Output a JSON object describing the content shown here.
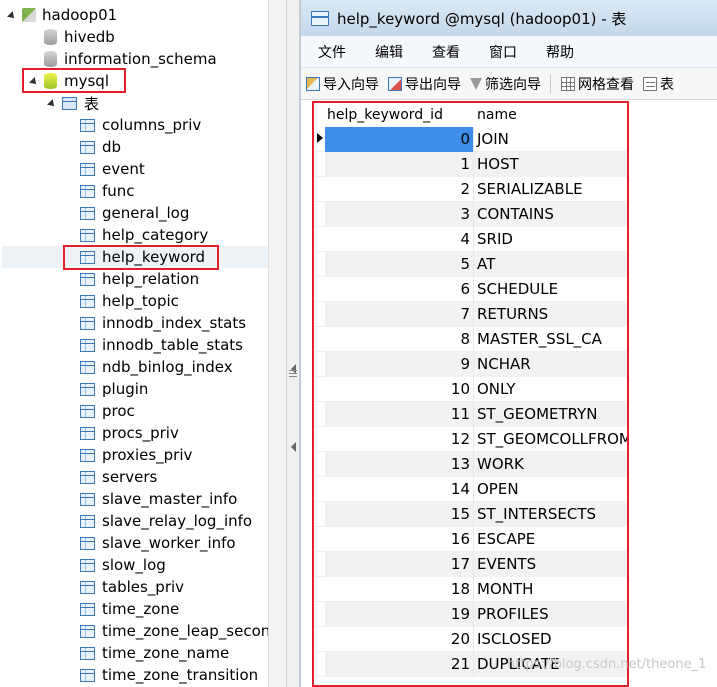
{
  "tree": {
    "connection": "hadoop01",
    "databases": [
      "hivedb",
      "information_schema",
      "mysql"
    ],
    "tables_folder": "表",
    "tables": [
      "columns_priv",
      "db",
      "event",
      "func",
      "general_log",
      "help_category",
      "help_keyword",
      "help_relation",
      "help_topic",
      "innodb_index_stats",
      "innodb_table_stats",
      "ndb_binlog_index",
      "plugin",
      "proc",
      "procs_priv",
      "proxies_priv",
      "servers",
      "slave_master_info",
      "slave_relay_log_info",
      "slave_worker_info",
      "slow_log",
      "tables_priv",
      "time_zone",
      "time_zone_leap_second",
      "time_zone_name",
      "time_zone_transition"
    ],
    "selected_table": "help_keyword"
  },
  "window": {
    "title": "help_keyword @mysql (hadoop01) - 表"
  },
  "menu": [
    "文件",
    "编辑",
    "查看",
    "窗口",
    "帮助"
  ],
  "toolbar": {
    "import": "导入向导",
    "export": "导出向导",
    "filter": "筛选向导",
    "grid_view": "网格查看",
    "form_view": "表"
  },
  "grid": {
    "columns": [
      "help_keyword_id",
      "name"
    ],
    "rows": [
      [
        "0",
        "JOIN"
      ],
      [
        "1",
        "HOST"
      ],
      [
        "2",
        "SERIALIZABLE"
      ],
      [
        "3",
        "CONTAINS"
      ],
      [
        "4",
        "SRID"
      ],
      [
        "5",
        "AT"
      ],
      [
        "6",
        "SCHEDULE"
      ],
      [
        "7",
        "RETURNS"
      ],
      [
        "8",
        "MASTER_SSL_CA"
      ],
      [
        "9",
        "NCHAR"
      ],
      [
        "10",
        "ONLY"
      ],
      [
        "11",
        "ST_GEOMETRYN"
      ],
      [
        "12",
        "ST_GEOMCOLLFROM"
      ],
      [
        "13",
        "WORK"
      ],
      [
        "14",
        "OPEN"
      ],
      [
        "15",
        "ST_INTERSECTS"
      ],
      [
        "16",
        "ESCAPE"
      ],
      [
        "17",
        "EVENTS"
      ],
      [
        "18",
        "MONTH"
      ],
      [
        "19",
        "PROFILES"
      ],
      [
        "20",
        "ISCLOSED"
      ],
      [
        "21",
        "DUPLICATE"
      ]
    ]
  },
  "watermark": "https://blog.csdn.net/theone_1",
  "colors": {
    "highlight": "#e0202a",
    "current_cell": "#3d8ee8"
  }
}
